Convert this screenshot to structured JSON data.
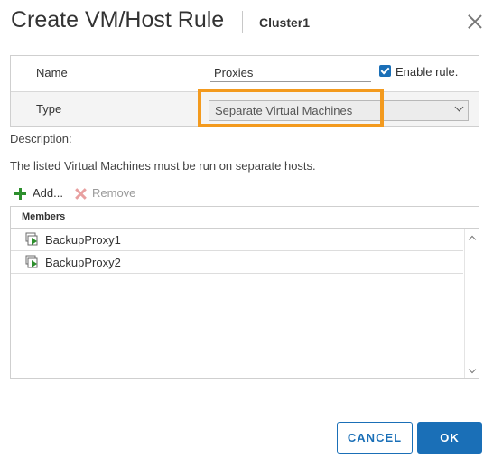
{
  "dialog": {
    "title": "Create VM/Host Rule",
    "subtitle": "Cluster1"
  },
  "form": {
    "name_label": "Name",
    "name_value": "Proxies",
    "enable_label": "Enable rule.",
    "enabled": true,
    "type_label": "Type",
    "type_value": "Separate Virtual Machines"
  },
  "description": {
    "label": "Description:",
    "text": "The listed Virtual Machines must be run on separate hosts."
  },
  "toolbar": {
    "add_label": "Add...",
    "remove_label": "Remove"
  },
  "members": {
    "header": "Members",
    "items": [
      {
        "name": "BackupProxy1"
      },
      {
        "name": "BackupProxy2"
      }
    ]
  },
  "buttons": {
    "cancel": "CANCEL",
    "ok": "OK"
  },
  "colors": {
    "accent": "#1a6fb7",
    "highlight": "#f39a1e",
    "add_icon": "#2d8f2d"
  }
}
